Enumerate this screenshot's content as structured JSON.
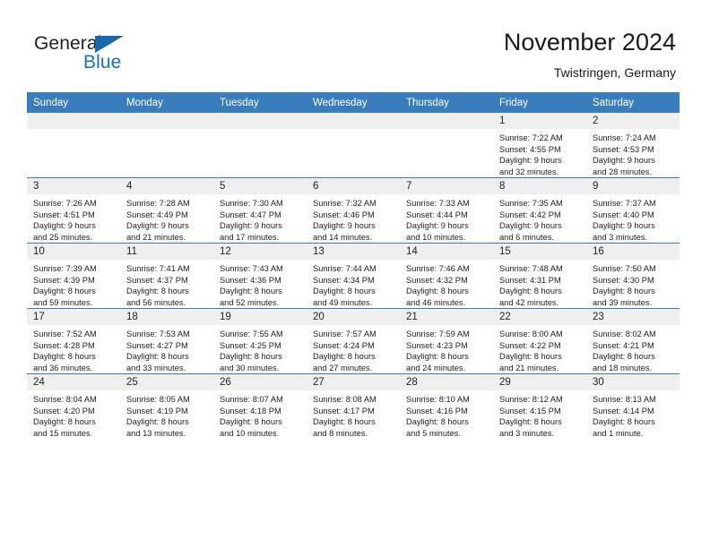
{
  "logo": {
    "word_top": "General",
    "word_bottom": "Blue",
    "triangle_color": "#1769aa",
    "blue_color": "#1a72b8"
  },
  "header": {
    "title": "November 2024",
    "subtitle": "Twistringen, Germany"
  },
  "theme": {
    "header_row_bg": "#3a7dbd",
    "daynum_band_bg": "#efefef",
    "row_separator": "#3a7dbd"
  },
  "weekday_headers": [
    "Sunday",
    "Monday",
    "Tuesday",
    "Wednesday",
    "Thursday",
    "Friday",
    "Saturday"
  ],
  "weeks": [
    [
      {
        "day": "",
        "sunrise": "",
        "sunset": "",
        "daylight1": "",
        "daylight2": ""
      },
      {
        "day": "",
        "sunrise": "",
        "sunset": "",
        "daylight1": "",
        "daylight2": ""
      },
      {
        "day": "",
        "sunrise": "",
        "sunset": "",
        "daylight1": "",
        "daylight2": ""
      },
      {
        "day": "",
        "sunrise": "",
        "sunset": "",
        "daylight1": "",
        "daylight2": ""
      },
      {
        "day": "",
        "sunrise": "",
        "sunset": "",
        "daylight1": "",
        "daylight2": ""
      },
      {
        "day": "1",
        "sunrise": "Sunrise: 7:22 AM",
        "sunset": "Sunset: 4:55 PM",
        "daylight1": "Daylight: 9 hours",
        "daylight2": "and 32 minutes."
      },
      {
        "day": "2",
        "sunrise": "Sunrise: 7:24 AM",
        "sunset": "Sunset: 4:53 PM",
        "daylight1": "Daylight: 9 hours",
        "daylight2": "and 28 minutes."
      }
    ],
    [
      {
        "day": "3",
        "sunrise": "Sunrise: 7:26 AM",
        "sunset": "Sunset: 4:51 PM",
        "daylight1": "Daylight: 9 hours",
        "daylight2": "and 25 minutes."
      },
      {
        "day": "4",
        "sunrise": "Sunrise: 7:28 AM",
        "sunset": "Sunset: 4:49 PM",
        "daylight1": "Daylight: 9 hours",
        "daylight2": "and 21 minutes."
      },
      {
        "day": "5",
        "sunrise": "Sunrise: 7:30 AM",
        "sunset": "Sunset: 4:47 PM",
        "daylight1": "Daylight: 9 hours",
        "daylight2": "and 17 minutes."
      },
      {
        "day": "6",
        "sunrise": "Sunrise: 7:32 AM",
        "sunset": "Sunset: 4:46 PM",
        "daylight1": "Daylight: 9 hours",
        "daylight2": "and 14 minutes."
      },
      {
        "day": "7",
        "sunrise": "Sunrise: 7:33 AM",
        "sunset": "Sunset: 4:44 PM",
        "daylight1": "Daylight: 9 hours",
        "daylight2": "and 10 minutes."
      },
      {
        "day": "8",
        "sunrise": "Sunrise: 7:35 AM",
        "sunset": "Sunset: 4:42 PM",
        "daylight1": "Daylight: 9 hours",
        "daylight2": "and 6 minutes."
      },
      {
        "day": "9",
        "sunrise": "Sunrise: 7:37 AM",
        "sunset": "Sunset: 4:40 PM",
        "daylight1": "Daylight: 9 hours",
        "daylight2": "and 3 minutes."
      }
    ],
    [
      {
        "day": "10",
        "sunrise": "Sunrise: 7:39 AM",
        "sunset": "Sunset: 4:39 PM",
        "daylight1": "Daylight: 8 hours",
        "daylight2": "and 59 minutes."
      },
      {
        "day": "11",
        "sunrise": "Sunrise: 7:41 AM",
        "sunset": "Sunset: 4:37 PM",
        "daylight1": "Daylight: 8 hours",
        "daylight2": "and 56 minutes."
      },
      {
        "day": "12",
        "sunrise": "Sunrise: 7:43 AM",
        "sunset": "Sunset: 4:36 PM",
        "daylight1": "Daylight: 8 hours",
        "daylight2": "and 52 minutes."
      },
      {
        "day": "13",
        "sunrise": "Sunrise: 7:44 AM",
        "sunset": "Sunset: 4:34 PM",
        "daylight1": "Daylight: 8 hours",
        "daylight2": "and 49 minutes."
      },
      {
        "day": "14",
        "sunrise": "Sunrise: 7:46 AM",
        "sunset": "Sunset: 4:32 PM",
        "daylight1": "Daylight: 8 hours",
        "daylight2": "and 46 minutes."
      },
      {
        "day": "15",
        "sunrise": "Sunrise: 7:48 AM",
        "sunset": "Sunset: 4:31 PM",
        "daylight1": "Daylight: 8 hours",
        "daylight2": "and 42 minutes."
      },
      {
        "day": "16",
        "sunrise": "Sunrise: 7:50 AM",
        "sunset": "Sunset: 4:30 PM",
        "daylight1": "Daylight: 8 hours",
        "daylight2": "and 39 minutes."
      }
    ],
    [
      {
        "day": "17",
        "sunrise": "Sunrise: 7:52 AM",
        "sunset": "Sunset: 4:28 PM",
        "daylight1": "Daylight: 8 hours",
        "daylight2": "and 36 minutes."
      },
      {
        "day": "18",
        "sunrise": "Sunrise: 7:53 AM",
        "sunset": "Sunset: 4:27 PM",
        "daylight1": "Daylight: 8 hours",
        "daylight2": "and 33 minutes."
      },
      {
        "day": "19",
        "sunrise": "Sunrise: 7:55 AM",
        "sunset": "Sunset: 4:25 PM",
        "daylight1": "Daylight: 8 hours",
        "daylight2": "and 30 minutes."
      },
      {
        "day": "20",
        "sunrise": "Sunrise: 7:57 AM",
        "sunset": "Sunset: 4:24 PM",
        "daylight1": "Daylight: 8 hours",
        "daylight2": "and 27 minutes."
      },
      {
        "day": "21",
        "sunrise": "Sunrise: 7:59 AM",
        "sunset": "Sunset: 4:23 PM",
        "daylight1": "Daylight: 8 hours",
        "daylight2": "and 24 minutes."
      },
      {
        "day": "22",
        "sunrise": "Sunrise: 8:00 AM",
        "sunset": "Sunset: 4:22 PM",
        "daylight1": "Daylight: 8 hours",
        "daylight2": "and 21 minutes."
      },
      {
        "day": "23",
        "sunrise": "Sunrise: 8:02 AM",
        "sunset": "Sunset: 4:21 PM",
        "daylight1": "Daylight: 8 hours",
        "daylight2": "and 18 minutes."
      }
    ],
    [
      {
        "day": "24",
        "sunrise": "Sunrise: 8:04 AM",
        "sunset": "Sunset: 4:20 PM",
        "daylight1": "Daylight: 8 hours",
        "daylight2": "and 15 minutes."
      },
      {
        "day": "25",
        "sunrise": "Sunrise: 8:05 AM",
        "sunset": "Sunset: 4:19 PM",
        "daylight1": "Daylight: 8 hours",
        "daylight2": "and 13 minutes."
      },
      {
        "day": "26",
        "sunrise": "Sunrise: 8:07 AM",
        "sunset": "Sunset: 4:18 PM",
        "daylight1": "Daylight: 8 hours",
        "daylight2": "and 10 minutes."
      },
      {
        "day": "27",
        "sunrise": "Sunrise: 8:08 AM",
        "sunset": "Sunset: 4:17 PM",
        "daylight1": "Daylight: 8 hours",
        "daylight2": "and 8 minutes."
      },
      {
        "day": "28",
        "sunrise": "Sunrise: 8:10 AM",
        "sunset": "Sunset: 4:16 PM",
        "daylight1": "Daylight: 8 hours",
        "daylight2": "and 5 minutes."
      },
      {
        "day": "29",
        "sunrise": "Sunrise: 8:12 AM",
        "sunset": "Sunset: 4:15 PM",
        "daylight1": "Daylight: 8 hours",
        "daylight2": "and 3 minutes."
      },
      {
        "day": "30",
        "sunrise": "Sunrise: 8:13 AM",
        "sunset": "Sunset: 4:14 PM",
        "daylight1": "Daylight: 8 hours",
        "daylight2": "and 1 minute."
      }
    ]
  ]
}
